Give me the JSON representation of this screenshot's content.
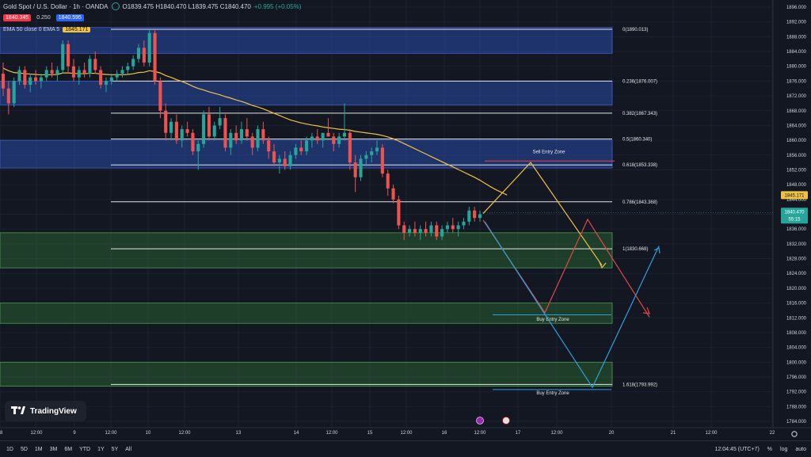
{
  "header": {
    "title": "Gold Spot / U.S. Dollar · 1h · OANDA",
    "ohlc": "O1839.475 H1840.470 L1839.475 C1840.470",
    "change": "+0.995 (+0.05%)",
    "sell_price": "1840.345",
    "spread": "0.250",
    "buy_price": "1840.595",
    "ema_label": "EMA 50 close 0 EMA 5",
    "ema_value": "1845.171"
  },
  "logo": {
    "text": "TradingView"
  },
  "bottom_bar": {
    "ranges": [
      "1D",
      "5D",
      "1M",
      "3M",
      "6M",
      "YTD",
      "1Y",
      "5Y",
      "All"
    ],
    "clock": "12:04:45 (UTC+7)",
    "percent": "%",
    "log": "log",
    "auto": "auto"
  },
  "chart_data": {
    "type": "candlestick",
    "title": "Gold Spot / U.S. Dollar · 1h · OANDA",
    "ylim": [
      1782,
      1898
    ],
    "y_ticks": [
      "1896.000",
      "1892.000",
      "1888.000",
      "1884.000",
      "1880.000",
      "1876.000",
      "1872.000",
      "1868.000",
      "1864.000",
      "1860.000",
      "1856.000",
      "1852.000",
      "1848.000",
      "1844.000",
      "1840.000",
      "1836.000",
      "1832.000",
      "1828.000",
      "1824.000",
      "1820.000",
      "1816.000",
      "1812.000",
      "1808.000",
      "1804.000",
      "1800.000",
      "1796.000",
      "1792.000",
      "1788.000",
      "1784.000"
    ],
    "x_ticks": [
      {
        "label": "8",
        "pos": 0
      },
      {
        "label": "12:00",
        "pos": 46
      },
      {
        "label": "9",
        "pos": 94
      },
      {
        "label": "12:00",
        "pos": 140
      },
      {
        "label": "10",
        "pos": 187
      },
      {
        "label": "12:00",
        "pos": 233
      },
      {
        "label": "13",
        "pos": 301
      },
      {
        "label": "14",
        "pos": 374
      },
      {
        "label": "12:00",
        "pos": 419
      },
      {
        "label": "15",
        "pos": 467
      },
      {
        "label": "12:00",
        "pos": 513
      },
      {
        "label": "16",
        "pos": 561
      },
      {
        "label": "12:00",
        "pos": 606
      },
      {
        "label": "17",
        "pos": 654
      },
      {
        "label": "12:00",
        "pos": 703
      },
      {
        "label": "20",
        "pos": 772
      },
      {
        "label": "21",
        "pos": 850
      },
      {
        "label": "12:00",
        "pos": 898
      },
      {
        "label": "22",
        "pos": 975
      }
    ],
    "current_price": "1840.470",
    "countdown": "55:15",
    "ema_price": "1845.171",
    "fib_levels": [
      {
        "label": "0(1890.013)",
        "price": 1890.013
      },
      {
        "label": "0.236(1876.007)",
        "price": 1876.007
      },
      {
        "label": "0.382(1867.343)",
        "price": 1867.343
      },
      {
        "label": "0.5(1860.340)",
        "price": 1860.34
      },
      {
        "label": "0.618(1853.338)",
        "price": 1853.338
      },
      {
        "label": "0.786(1843.368)",
        "price": 1843.368
      },
      {
        "label": "1(1830.668)",
        "price": 1830.668
      },
      {
        "label": "1.618(1793.992)",
        "price": 1793.992
      }
    ],
    "zones": [
      {
        "kind": "supply",
        "from": 1883.5,
        "to": 1890.5
      },
      {
        "kind": "supply",
        "from": 1869.5,
        "to": 1876.0
      },
      {
        "kind": "supply",
        "from": 1852.5,
        "to": 1860.0
      },
      {
        "kind": "demand",
        "from": 1825.5,
        "to": 1835.0
      },
      {
        "kind": "demand",
        "from": 1810.5,
        "to": 1816.0
      },
      {
        "kind": "demand",
        "from": 1793.5,
        "to": 1800.0
      }
    ],
    "annotations": [
      {
        "text": "Sell Entry Zone",
        "price": 1856.5,
        "pos": 693
      },
      {
        "text": "Buy Entry Zone",
        "price": 1811.2,
        "pos": 698
      },
      {
        "text": "Buy Entry Zone",
        "price": 1791.3,
        "pos": 698
      }
    ],
    "candles": [
      [
        1878,
        1881,
        1872,
        1874
      ],
      [
        1874,
        1876,
        1867,
        1870
      ],
      [
        1870,
        1877,
        1869,
        1876
      ],
      [
        1876,
        1880,
        1875,
        1879
      ],
      [
        1879,
        1880,
        1874,
        1875
      ],
      [
        1875,
        1878,
        1873,
        1877
      ],
      [
        1877,
        1879,
        1875,
        1876
      ],
      [
        1876,
        1878,
        1874,
        1877
      ],
      [
        1877,
        1880,
        1876,
        1879
      ],
      [
        1879,
        1881,
        1877,
        1878
      ],
      [
        1878,
        1880,
        1876,
        1879
      ],
      [
        1879,
        1887,
        1878,
        1886
      ],
      [
        1886,
        1887,
        1878,
        1880
      ],
      [
        1880,
        1882,
        1876,
        1877
      ],
      [
        1877,
        1880,
        1875,
        1879
      ],
      [
        1879,
        1881,
        1877,
        1878
      ],
      [
        1878,
        1883,
        1877,
        1882
      ],
      [
        1882,
        1884,
        1878,
        1879
      ],
      [
        1879,
        1880,
        1874,
        1875
      ],
      [
        1875,
        1877,
        1873,
        1876
      ],
      [
        1876,
        1878,
        1875,
        1877
      ],
      [
        1877,
        1879,
        1876,
        1878
      ],
      [
        1878,
        1880,
        1877,
        1879
      ],
      [
        1879,
        1881,
        1878,
        1880
      ],
      [
        1880,
        1883,
        1879,
        1882
      ],
      [
        1882,
        1886,
        1881,
        1885
      ],
      [
        1885,
        1887,
        1880,
        1881
      ],
      [
        1881,
        1890,
        1880,
        1889
      ],
      [
        1889,
        1890,
        1875,
        1876
      ],
      [
        1876,
        1877,
        1866,
        1868
      ],
      [
        1868,
        1870,
        1860,
        1862
      ],
      [
        1862,
        1866,
        1860,
        1865
      ],
      [
        1865,
        1867,
        1859,
        1860
      ],
      [
        1860,
        1864,
        1858,
        1863
      ],
      [
        1863,
        1865,
        1861,
        1862
      ],
      [
        1862,
        1863,
        1856,
        1857
      ],
      [
        1857,
        1860,
        1852,
        1859
      ],
      [
        1859,
        1868,
        1858,
        1867
      ],
      [
        1867,
        1869,
        1860,
        1861
      ],
      [
        1861,
        1865,
        1860,
        1864
      ],
      [
        1864,
        1869,
        1863,
        1866
      ],
      [
        1866,
        1867,
        1857,
        1858
      ],
      [
        1858,
        1863,
        1856,
        1862
      ],
      [
        1862,
        1864,
        1859,
        1860
      ],
      [
        1860,
        1865,
        1859,
        1863
      ],
      [
        1863,
        1866,
        1860,
        1861
      ],
      [
        1861,
        1862,
        1856,
        1858
      ],
      [
        1858,
        1864,
        1857,
        1863
      ],
      [
        1863,
        1865,
        1859,
        1860
      ],
      [
        1860,
        1861,
        1855,
        1857
      ],
      [
        1857,
        1859,
        1853,
        1854
      ],
      [
        1854,
        1856,
        1851,
        1855
      ],
      [
        1855,
        1857,
        1852,
        1853
      ],
      [
        1853,
        1857,
        1852,
        1856
      ],
      [
        1856,
        1859,
        1855,
        1858
      ],
      [
        1858,
        1860,
        1856,
        1857
      ],
      [
        1857,
        1861,
        1856,
        1860
      ],
      [
        1860,
        1862,
        1858,
        1861
      ],
      [
        1861,
        1863,
        1859,
        1860
      ],
      [
        1860,
        1862,
        1858,
        1862
      ],
      [
        1862,
        1866,
        1861,
        1861
      ],
      [
        1861,
        1862,
        1857,
        1859
      ],
      [
        1859,
        1862,
        1858,
        1861
      ],
      [
        1861,
        1870,
        1860,
        1862
      ],
      [
        1862,
        1863,
        1852,
        1854
      ],
      [
        1854,
        1856,
        1846,
        1850
      ],
      [
        1850,
        1856,
        1849,
        1855
      ],
      [
        1855,
        1857,
        1853,
        1856
      ],
      [
        1856,
        1858,
        1854,
        1857
      ],
      [
        1857,
        1860,
        1856,
        1858
      ],
      [
        1858,
        1859,
        1850,
        1851
      ],
      [
        1851,
        1852,
        1845,
        1847
      ],
      [
        1847,
        1848,
        1843,
        1844
      ],
      [
        1844,
        1845,
        1836,
        1837
      ],
      [
        1837,
        1838,
        1833,
        1835
      ],
      [
        1835,
        1837,
        1834,
        1836
      ],
      [
        1836,
        1838,
        1834,
        1835
      ],
      [
        1835,
        1837,
        1833,
        1836
      ],
      [
        1836,
        1838,
        1834,
        1835
      ],
      [
        1835,
        1838,
        1834,
        1837
      ],
      [
        1837,
        1838,
        1833,
        1834
      ],
      [
        1834,
        1837,
        1833,
        1836
      ],
      [
        1836,
        1838,
        1835,
        1837
      ],
      [
        1837,
        1839,
        1835,
        1836
      ],
      [
        1836,
        1838,
        1834,
        1837
      ],
      [
        1837,
        1839,
        1836,
        1838
      ],
      [
        1838,
        1842,
        1837,
        1841
      ],
      [
        1841,
        1842,
        1838,
        1839
      ],
      [
        1839,
        1841,
        1838,
        1840
      ]
    ],
    "ema": [
      1879.5,
      1878.8,
      1878.3,
      1878.2,
      1878.0,
      1877.9,
      1877.8,
      1877.7,
      1877.7,
      1877.7,
      1877.8,
      1878.2,
      1878.2,
      1878.1,
      1878.0,
      1878.0,
      1878.1,
      1878.1,
      1877.9,
      1877.8,
      1877.7,
      1877.7,
      1877.7,
      1877.8,
      1878.0,
      1878.3,
      1878.4,
      1878.8,
      1878.6,
      1878.2,
      1877.5,
      1877.0,
      1876.4,
      1875.9,
      1875.3,
      1874.6,
      1874.0,
      1873.6,
      1873.1,
      1872.7,
      1872.3,
      1871.8,
      1871.4,
      1870.9,
      1870.5,
      1870.0,
      1869.4,
      1869.0,
      1868.5,
      1867.9,
      1867.3,
      1866.7,
      1866.1,
      1865.5,
      1865.1,
      1864.7,
      1864.4,
      1864.1,
      1863.9,
      1863.6,
      1863.4,
      1863.2,
      1863.0,
      1862.9,
      1862.7,
      1862.4,
      1862.2,
      1862.0,
      1861.8,
      1861.6,
      1861.3,
      1860.9,
      1860.4,
      1859.8,
      1859.1,
      1858.4,
      1857.7,
      1857.0,
      1856.3,
      1855.6,
      1854.9,
      1854.2,
      1853.5,
      1852.8,
      1852.1,
      1851.4,
      1850.7,
      1850.0,
      1849.2,
      1848.3,
      1847.4,
      1846.6,
      1845.9,
      1845.2
    ]
  }
}
